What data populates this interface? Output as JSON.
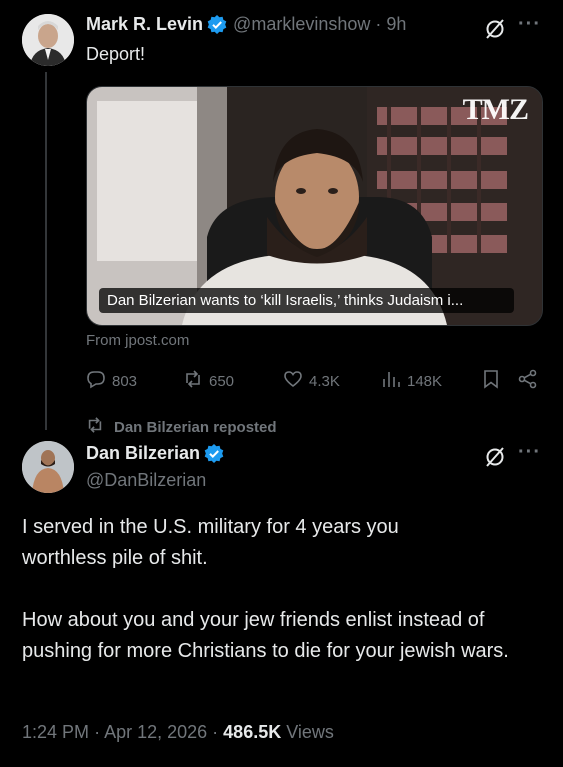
{
  "tweet1": {
    "name": "Mark R. Levin",
    "handle": "@marklevinshow",
    "time": "9h",
    "text": "Deport!",
    "card": {
      "watermark": "TMZ",
      "caption": "Dan Bilzerian wants to ‘kill Israelis,’ thinks Judaism i...",
      "source": "From jpost.com"
    },
    "stats": {
      "replies": "803",
      "reposts": "650",
      "likes": "4.3K",
      "views": "148K"
    }
  },
  "repost_label": "Dan Bilzerian reposted",
  "tweet2": {
    "name": "Dan Bilzerian",
    "handle": "@DanBilzerian",
    "text_line1": "I served in the U.S. military for 4 years you worthless pile of shit.",
    "text_line2": "How about you and your jew friends enlist instead of pushing for more Christians to die for your jewish wars.",
    "time": "1:24 PM",
    "date": "Apr 12, 2026",
    "views_count": "486.5K",
    "views_label": "Views"
  },
  "colors": {
    "background": "#000000",
    "text": "#e7e9ea",
    "muted": "#71767b",
    "verified": "#1d9bf0"
  }
}
